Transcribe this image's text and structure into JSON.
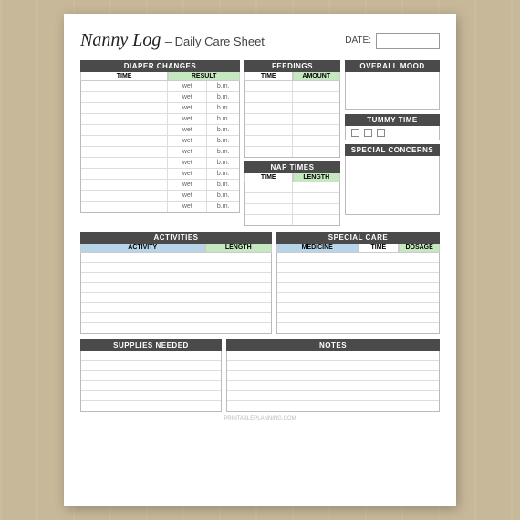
{
  "header": {
    "title_italic": "Nanny Log",
    "title_dash": " – Daily Care Sheet",
    "date_label": "DATE:"
  },
  "diaper": {
    "section_label": "DIAPER CHANGES",
    "col_time": "TIME",
    "col_result": "RESULT",
    "rows": [
      {
        "time": "",
        "result": "wet",
        "suffix": "b.m."
      },
      {
        "time": "",
        "result": "wet",
        "suffix": "b.m."
      },
      {
        "time": "",
        "result": "wet",
        "suffix": "b.m."
      },
      {
        "time": "",
        "result": "wet",
        "suffix": "b.m."
      },
      {
        "time": "",
        "result": "wet",
        "suffix": "b.m."
      },
      {
        "time": "",
        "result": "wet",
        "suffix": "b.m."
      },
      {
        "time": "",
        "result": "wet",
        "suffix": "b.m."
      },
      {
        "time": "",
        "result": "wet",
        "suffix": "b.m."
      },
      {
        "time": "",
        "result": "wet",
        "suffix": "b.m."
      },
      {
        "time": "",
        "result": "wet",
        "suffix": "b.m."
      },
      {
        "time": "",
        "result": "wet",
        "suffix": "b.m."
      },
      {
        "time": "",
        "result": "wet",
        "suffix": "b.m."
      }
    ]
  },
  "feedings": {
    "section_label": "FEEDINGS",
    "col_time": "TIME",
    "col_amount": "AMOUNT",
    "rows_count": 7
  },
  "nap": {
    "section_label": "NAP TIMES",
    "col_time": "TIME",
    "col_length": "LENGTH",
    "rows_count": 4
  },
  "overall_mood": {
    "section_label": "OVERALL MOOD"
  },
  "tummy": {
    "section_label": "TUMMY TIME",
    "checkboxes": 3
  },
  "special_concerns": {
    "section_label": "SPECIAL CONCERNS"
  },
  "activities": {
    "section_label": "ACTIVITIES",
    "col_activity": "ACTIVITY",
    "col_length": "LENGTH",
    "rows_count": 8
  },
  "special_care": {
    "section_label": "SPECIAL CARE",
    "col_medicine": "MEDICINE",
    "col_time": "TIME",
    "col_dosage": "DOSAGE",
    "rows_count": 8
  },
  "supplies": {
    "section_label": "SUPPLIES NEEDED",
    "rows_count": 6
  },
  "notes": {
    "section_label": "NOTES",
    "rows_count": 6
  },
  "footer": {
    "text": "PRINTABLEPLANNING.COM"
  }
}
